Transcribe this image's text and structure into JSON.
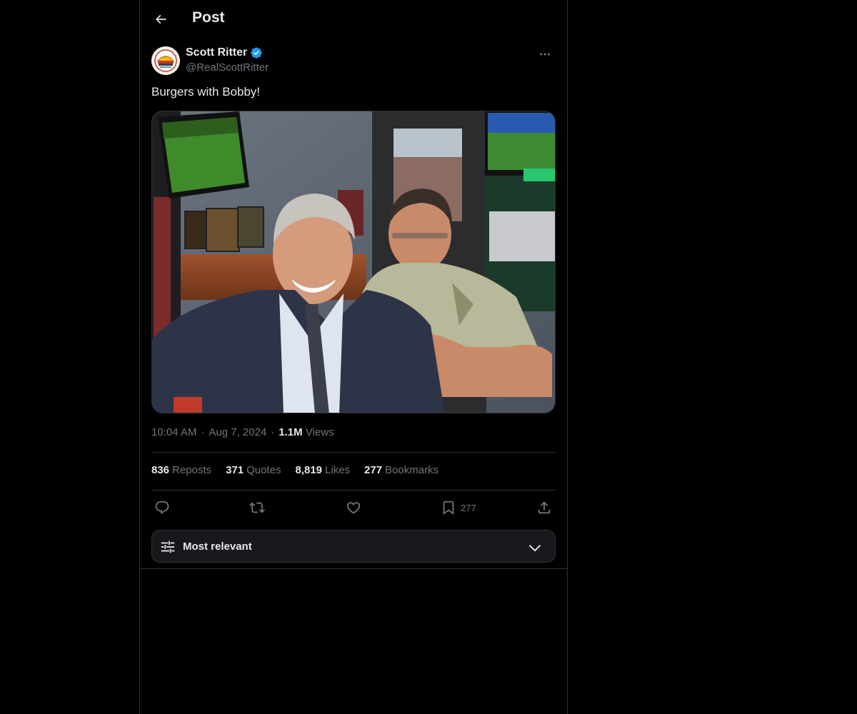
{
  "header": {
    "title": "Post",
    "back_icon": "arrow-left-icon"
  },
  "author": {
    "name": "Scott Ritter",
    "handle": "@RealScottRitter",
    "verified": true,
    "verified_color": "#1d9bf0"
  },
  "post": {
    "text": "Burgers with Bobby!",
    "time": "10:04 AM",
    "date": "Aug 7, 2024",
    "views_count": "1.1M",
    "views_label": "Views"
  },
  "stats": {
    "reposts_count": "836",
    "reposts_label": "Reposts",
    "quotes_count": "371",
    "quotes_label": "Quotes",
    "likes_count": "8,819",
    "likes_label": "Likes",
    "bookmarks_count": "277",
    "bookmarks_label": "Bookmarks"
  },
  "actions": {
    "reply_icon": "reply-icon",
    "repost_icon": "repost-icon",
    "like_icon": "heart-icon",
    "bookmark_icon": "bookmark-icon",
    "bookmark_count": "277",
    "share_icon": "share-icon"
  },
  "replies_sort": {
    "label": "Most relevant"
  },
  "colors": {
    "background": "#000000",
    "border": "#2f3336",
    "text_primary": "#e7e9ea",
    "text_secondary": "#71767b",
    "accent": "#1d9bf0"
  }
}
